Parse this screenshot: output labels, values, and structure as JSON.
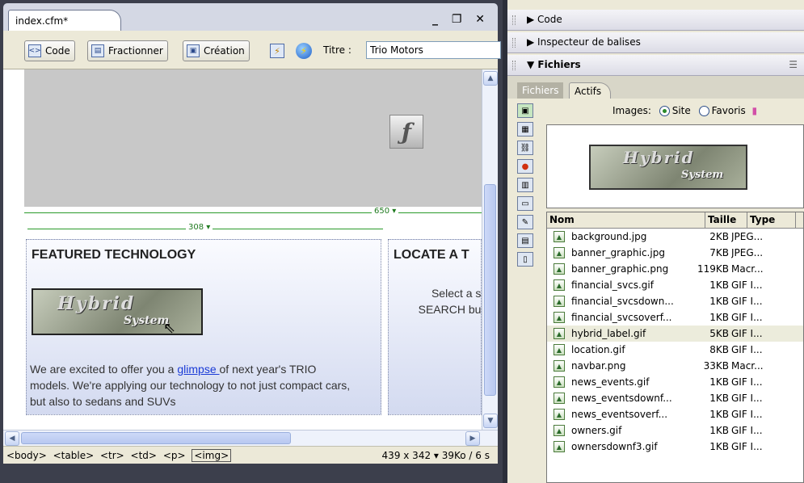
{
  "document": {
    "tab_title": "index.cfm*",
    "window_controls": "_ ❐ ✕"
  },
  "toolbar": {
    "code_label": "Code",
    "split_label": "Fractionner",
    "design_label": "Création",
    "title_label": "Titre :",
    "title_value": "Trio Motors"
  },
  "canvas": {
    "ruler_total": "650 ▾",
    "ruler_col": "308 ▾",
    "left_heading": "FEATURED TECHNOLOGY",
    "right_heading": "LOCATE A T",
    "hybrid_word": "Hybrid",
    "system_word": "System",
    "para_before": "We are excited to offer you a ",
    "para_link": "glimpse ",
    "para_after": "of next year's TRIO models. We're applying our technology to not just compact cars, but also to sedans and SUVs",
    "right_text": "Select a stat SEARCH butto"
  },
  "statusbar": {
    "tags": [
      "<body>",
      "<table>",
      "<tr>",
      "<td>",
      "<p>"
    ],
    "selected_tag": "<img>",
    "size_info": "439 x 342 ▾ 39Ko / 6 s"
  },
  "panels": {
    "code": "Code",
    "tag_inspector": "Inspecteur de balises",
    "files": "Fichiers",
    "tab_files": "Fichiers",
    "tab_assets": "Actifs",
    "images_label": "Images:",
    "opt_site": "Site",
    "opt_favorites": "Favoris"
  },
  "file_columns": [
    "Nom",
    "Taille",
    "Type"
  ],
  "files": [
    {
      "name": "background.jpg",
      "size": "2KB",
      "type": "JPEG..."
    },
    {
      "name": "banner_graphic.jpg",
      "size": "7KB",
      "type": "JPEG..."
    },
    {
      "name": "banner_graphic.png",
      "size": "119KB",
      "type": "Macr..."
    },
    {
      "name": "financial_svcs.gif",
      "size": "1KB",
      "type": "GIF I..."
    },
    {
      "name": "financial_svcsdown...",
      "size": "1KB",
      "type": "GIF I..."
    },
    {
      "name": "financial_svcsoverf...",
      "size": "1KB",
      "type": "GIF I..."
    },
    {
      "name": "hybrid_label.gif",
      "size": "5KB",
      "type": "GIF I..."
    },
    {
      "name": "location.gif",
      "size": "8KB",
      "type": "GIF I..."
    },
    {
      "name": "navbar.png",
      "size": "33KB",
      "type": "Macr..."
    },
    {
      "name": "news_events.gif",
      "size": "1KB",
      "type": "GIF I..."
    },
    {
      "name": "news_eventsdownf...",
      "size": "1KB",
      "type": "GIF I..."
    },
    {
      "name": "news_eventsoverf...",
      "size": "1KB",
      "type": "GIF I..."
    },
    {
      "name": "owners.gif",
      "size": "1KB",
      "type": "GIF I..."
    },
    {
      "name": "ownersdownf3.gif",
      "size": "1KB",
      "type": "GIF I..."
    }
  ],
  "highlighted_file": 6
}
